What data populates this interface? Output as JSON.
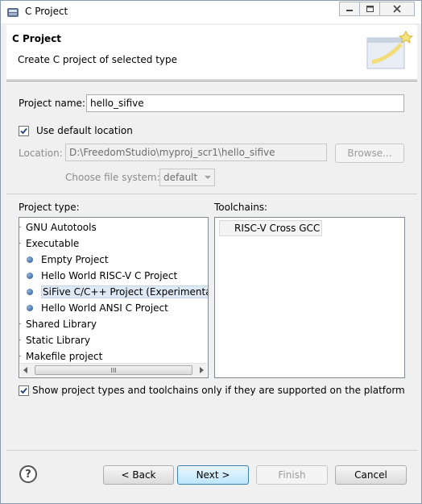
{
  "window": {
    "title": "C Project",
    "controls": {
      "minimize": "minimize-icon",
      "restore": "restore-icon",
      "close": "close-icon"
    }
  },
  "banner": {
    "title": "C Project",
    "subtitle": "Create C project of selected type"
  },
  "form": {
    "project_name_label": "Project name:",
    "project_name_value": "hello_sifive",
    "use_default_location_label": "Use default location",
    "use_default_location_checked": true,
    "location_label": "Location:",
    "location_value": "D:\\FreedomStudio\\myproj_scr1\\hello_sifive",
    "browse_label": "Browse...",
    "file_system_label": "Choose file system:",
    "file_system_value": "default"
  },
  "project_types": {
    "label": "Project type:",
    "items": [
      {
        "label": "GNU Autotools",
        "level": 0
      },
      {
        "label": "Executable",
        "level": 0
      },
      {
        "label": "Empty Project",
        "level": 1
      },
      {
        "label": "Hello World RISC-V C Project",
        "level": 1
      },
      {
        "label": "SiFive C/C++ Project (Experimental)",
        "level": 1,
        "selected": true
      },
      {
        "label": "Hello World ANSI C Project",
        "level": 1
      },
      {
        "label": "Shared Library",
        "level": 0
      },
      {
        "label": "Static Library",
        "level": 0
      },
      {
        "label": "Makefile project",
        "level": 0
      }
    ],
    "scroll_grip": "III"
  },
  "toolchains": {
    "label": "Toolchains:",
    "items": [
      {
        "label": "RISC-V Cross GCC"
      }
    ]
  },
  "filter": {
    "label": "Show project types and toolchains only if they are supported on the platform",
    "checked": true
  },
  "buttons": {
    "help": "?",
    "back": "< Back",
    "next": "Next >",
    "finish": "Finish",
    "cancel": "Cancel"
  },
  "colors": {
    "selection": "#dfe9f5",
    "default_button": "#3c7fb1",
    "window_bg": "#f0f0f0"
  }
}
